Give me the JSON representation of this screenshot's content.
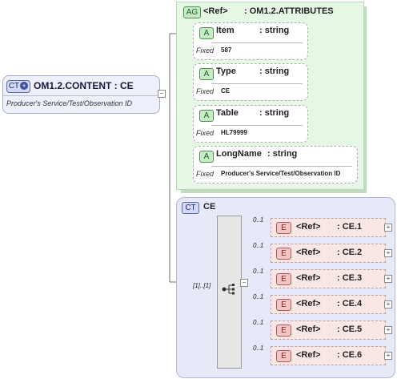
{
  "root": {
    "tag": "CT",
    "name": "OM1.2.CONTENT : CE",
    "description": "Producer's Service/Test/Observation ID"
  },
  "attributes_group": {
    "tag": "AG",
    "ref_label": "<Ref>",
    "name": ": OM1.2.ATTRIBUTES",
    "attribute_tag": "A",
    "fixed_label": "Fixed",
    "items": [
      {
        "name": "Item",
        "type": ": string",
        "fixed": "587"
      },
      {
        "name": "Type",
        "type": ": string",
        "fixed": "CE"
      },
      {
        "name": "Table",
        "type": ": string",
        "fixed": "HL79999"
      },
      {
        "name": "LongName",
        "type": ": string",
        "fixed": "Producer's Service/Test/Observation ID"
      }
    ]
  },
  "complex_type": {
    "tag": "CT",
    "name": "CE",
    "sequence_occurrence": "[1]..[1]",
    "element_tag": "E",
    "elements": [
      {
        "occurrence": "0..1",
        "ref": "<Ref>",
        "name": ": CE.1"
      },
      {
        "occurrence": "0..1",
        "ref": "<Ref>",
        "name": ": CE.2"
      },
      {
        "occurrence": "0..1",
        "ref": "<Ref>",
        "name": ": CE.3"
      },
      {
        "occurrence": "0..1",
        "ref": "<Ref>",
        "name": ": CE.4"
      },
      {
        "occurrence": "0..1",
        "ref": "<Ref>",
        "name": ": CE.5"
      },
      {
        "occurrence": "0..1",
        "ref": "<Ref>",
        "name": ": CE.6"
      }
    ]
  },
  "icons": {
    "expand": "plus-icon",
    "collapse": "minus-icon",
    "sequence": "sequence-icon"
  },
  "colors": {
    "root_bg": "#eef0fc",
    "attr_group_bg": "#e6f7e6",
    "element_bg": "#fbe6e6",
    "complex_bg": "#e7e9f8"
  }
}
